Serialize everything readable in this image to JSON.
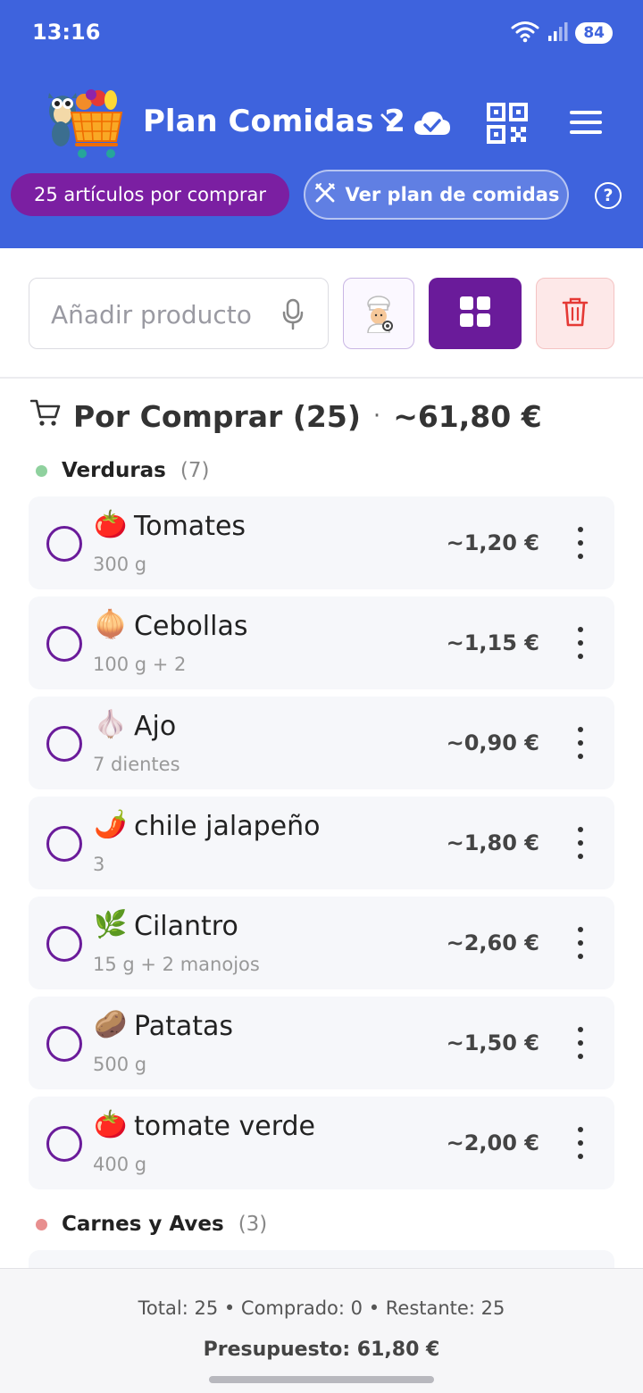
{
  "status_bar": {
    "time": "13:16",
    "battery": "84"
  },
  "app_bar": {
    "title": "Plan Comidas 2"
  },
  "chips": {
    "items_to_buy": "25 artículos por comprar",
    "meal_plan": "Ver plan de comidas",
    "help": "?"
  },
  "search": {
    "placeholder": "Añadir producto"
  },
  "section": {
    "title": "Por Comprar (25)",
    "separator": "·",
    "total": "~61,80 €"
  },
  "categories": [
    {
      "name": "Verduras",
      "count": "(7)",
      "color": "#8fd19e"
    },
    {
      "name": "Carnes y Aves",
      "count": "(3)",
      "color": "#e88f8f"
    }
  ],
  "items": [
    {
      "emoji": "🍅",
      "name": "Tomates",
      "qty": "300 g",
      "price": "~1,20 €"
    },
    {
      "emoji": "🧅",
      "name": "Cebollas",
      "qty": "100 g + 2",
      "price": "~1,15 €"
    },
    {
      "emoji": "🧄",
      "name": "Ajo",
      "qty": "7 dientes",
      "price": "~0,90 €"
    },
    {
      "emoji": "🌶️",
      "name": "chile jalapeño",
      "qty": "3",
      "price": "~1,80 €"
    },
    {
      "emoji": "🌿",
      "name": "Cilantro",
      "qty": "15 g + 2 manojos",
      "price": "~2,60 €"
    },
    {
      "emoji": "🥔",
      "name": "Patatas",
      "qty": "500 g",
      "price": "~1,50 €"
    },
    {
      "emoji": "🍅",
      "name": "tomate verde",
      "qty": "400 g",
      "price": "~2,00 €"
    }
  ],
  "footer": {
    "stats": "Total: 25 • Comprado: 0 • Restante: 25",
    "budget": "Presupuesto: 61,80 €"
  },
  "colors": {
    "header": "#3e63dd",
    "accent_purple": "#6a1b9a",
    "chip_purple": "#7b1fa2"
  },
  "icons": [
    "wifi-icon",
    "signal-icon",
    "chevron-down-icon",
    "cloud-check-icon",
    "qr-code-icon",
    "menu-icon",
    "utensils-icon",
    "help-icon",
    "mic-icon",
    "chef-icon",
    "grid-icon",
    "trash-icon",
    "cart-icon",
    "more-vertical-icon"
  ]
}
